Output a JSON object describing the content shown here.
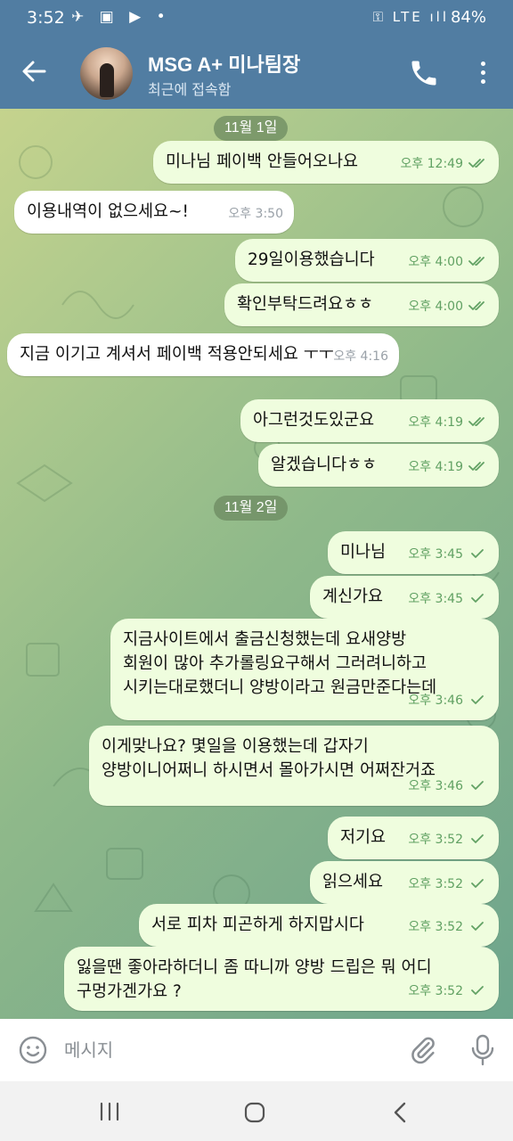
{
  "status_bar": {
    "time": "3:52",
    "left_icons": [
      "telegram-icon",
      "gallery-icon",
      "youtube-icon",
      "dot-icon"
    ],
    "left_icons_text": "✈ ▣ ▶ •",
    "right_icons_text": "⚿ LTE ıll",
    "battery": "84%"
  },
  "header": {
    "title": "MSG A+ 미나팀장",
    "status": "최근에 접속함"
  },
  "messages": [
    {
      "type": "date",
      "text": "11월 1일"
    },
    {
      "type": "out",
      "text": "미나님 페이백 안들어오나요",
      "time": "오후 12:49",
      "read": true
    },
    {
      "type": "in",
      "text": "이용내역이 없으세요~!",
      "time": "오후 3:50"
    },
    {
      "type": "out",
      "text": "29일이용했습니다",
      "time": "오후 4:00",
      "read": true
    },
    {
      "type": "out",
      "text": "확인부탁드려요ㅎㅎ",
      "time": "오후 4:00",
      "read": true
    },
    {
      "type": "in",
      "text": "지금 이기고 계셔서 페이백 적용안되세요 ㅜㅜ",
      "time": "오후 4:16"
    },
    {
      "type": "out",
      "text": "아그런것도있군요",
      "time": "오후 4:19",
      "read": true
    },
    {
      "type": "out",
      "text": "알겠습니다ㅎㅎ",
      "time": "오후 4:19",
      "read": true
    },
    {
      "type": "date",
      "text": "11월 2일"
    },
    {
      "type": "out",
      "text": "미나님",
      "time": "오후 3:45",
      "read": false
    },
    {
      "type": "out",
      "text": "계신가요",
      "time": "오후 3:45",
      "read": false
    },
    {
      "type": "out",
      "text": "지금사이트에서 출금신청했는데 요새양방\n회원이 많아 추가롤링요구해서 그러려니하고\n시키는대로했더니 양방이라고 원금만준다는데",
      "time": "오후 3:46",
      "read": false
    },
    {
      "type": "out",
      "text": "이게맞나요? 몇일을 이용했는데 갑자기\n양방이니어쩌니 하시면서 몰아가시면 어쩌잔거죠",
      "time": "오후 3:46",
      "read": false
    },
    {
      "type": "out",
      "text": "저기요",
      "time": "오후 3:52",
      "read": false
    },
    {
      "type": "out",
      "text": "읽으세요",
      "time": "오후 3:52",
      "read": false
    },
    {
      "type": "out",
      "text": "서로 피차 피곤하게 하지맙시다",
      "time": "오후 3:52",
      "read": false
    },
    {
      "type": "out",
      "text": "잃을땐 좋아라하더니 좀 따니까 양방 드립은 뭐 어디\n구멍가겐가요 ?",
      "time": "오후 3:52",
      "read": false
    }
  ],
  "input": {
    "placeholder": "메시지"
  },
  "colors": {
    "header_bg": "#517da2",
    "outgoing_bubble": "#effdde",
    "incoming_bubble": "#ffffff",
    "checkmark": "#61a163"
  }
}
